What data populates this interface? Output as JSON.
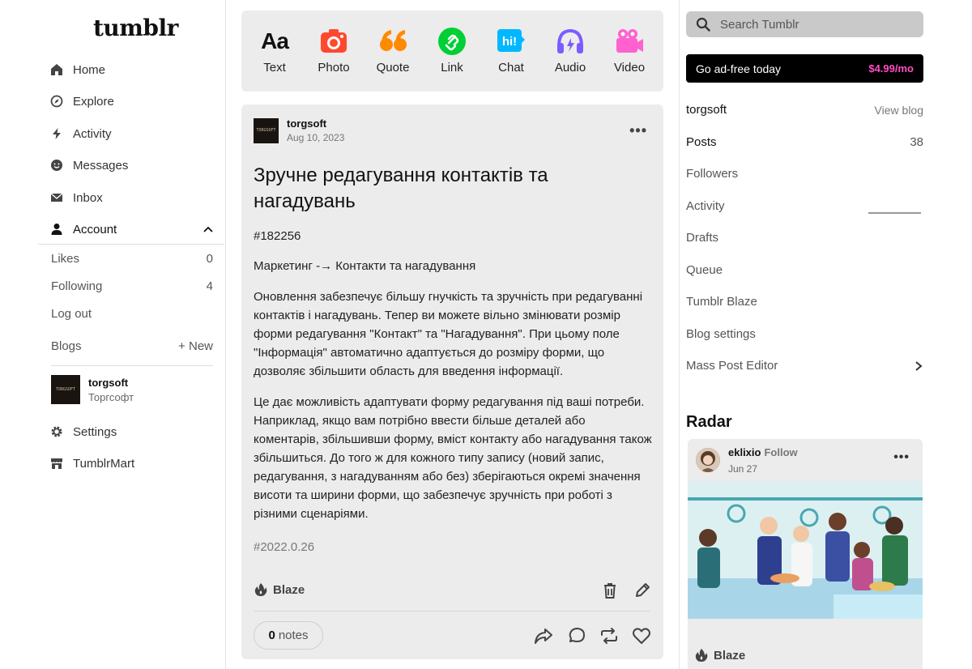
{
  "brand": {
    "logo": "tumblr"
  },
  "nav": {
    "home": "Home",
    "explore": "Explore",
    "activity": "Activity",
    "messages": "Messages",
    "inbox": "Inbox",
    "account": "Account"
  },
  "account_menu": {
    "likes": {
      "label": "Likes",
      "count": "0"
    },
    "following": {
      "label": "Following",
      "count": "4"
    },
    "logout": "Log out",
    "blogs": "Blogs",
    "new_blog": "+ New"
  },
  "blog": {
    "name": "torgsoft",
    "title": "Торгсофт",
    "avatar_text": "TORGSOFT"
  },
  "nav_bottom": {
    "settings": "Settings",
    "mart": "TumblrMart"
  },
  "composer": {
    "text": "Text",
    "photo": "Photo",
    "quote": "Quote",
    "link": "Link",
    "chat": "Chat",
    "audio": "Audio",
    "video": "Video"
  },
  "post": {
    "blog": "torgsoft",
    "date": "Aug 10, 2023",
    "title": "Зручне редагування контактів та нагадувань",
    "id_tag": "#182256",
    "path": "Маркетинг -→ Контакти та нагадування",
    "para1": "Оновлення забезпечує більшу гнучкість та зручність при редагуванні контактів і нагадувань. Тепер ви можете вільно змінювати розмір форми редагування \"Контакт\" та \"Нагадування\". При цьому поле \"Інформація\" автоматично адаптується до розміру форми, що дозволяє збільшити область для введення інформації.",
    "para2": "Це дає можливість адаптувати форму редагування під ваші потреби. Наприклад, якщо вам потрібно ввести більше деталей або коментарів, збільшивши форму, вміст контакту або нагадування також збільшиться. До того ж для кожного типу запису (новий запис, редагування, з нагадуванням або без) зберігаються окремі значення висоти та ширини форми, що забезпечує зручність при роботі з різними сценаріями.",
    "version_tag": "#2022.0.26",
    "blaze": "Blaze",
    "notes_count": "0",
    "notes_label": "notes"
  },
  "sidebar": {
    "search_placeholder": "Search Tumblr",
    "adfree_label": "Go ad-free today",
    "adfree_price": "$4.99/mo",
    "blog_name": "torgsoft",
    "view_blog": "View blog",
    "posts": "Posts",
    "posts_count": "38",
    "followers": "Followers",
    "activity": "Activity",
    "drafts": "Drafts",
    "queue": "Queue",
    "blaze": "Tumblr Blaze",
    "blog_settings": "Blog settings",
    "mass_editor": "Mass Post Editor"
  },
  "radar": {
    "title": "Radar",
    "blog": "eklixio",
    "follow": "Follow",
    "date": "Jun 27",
    "blaze": "Blaze"
  }
}
